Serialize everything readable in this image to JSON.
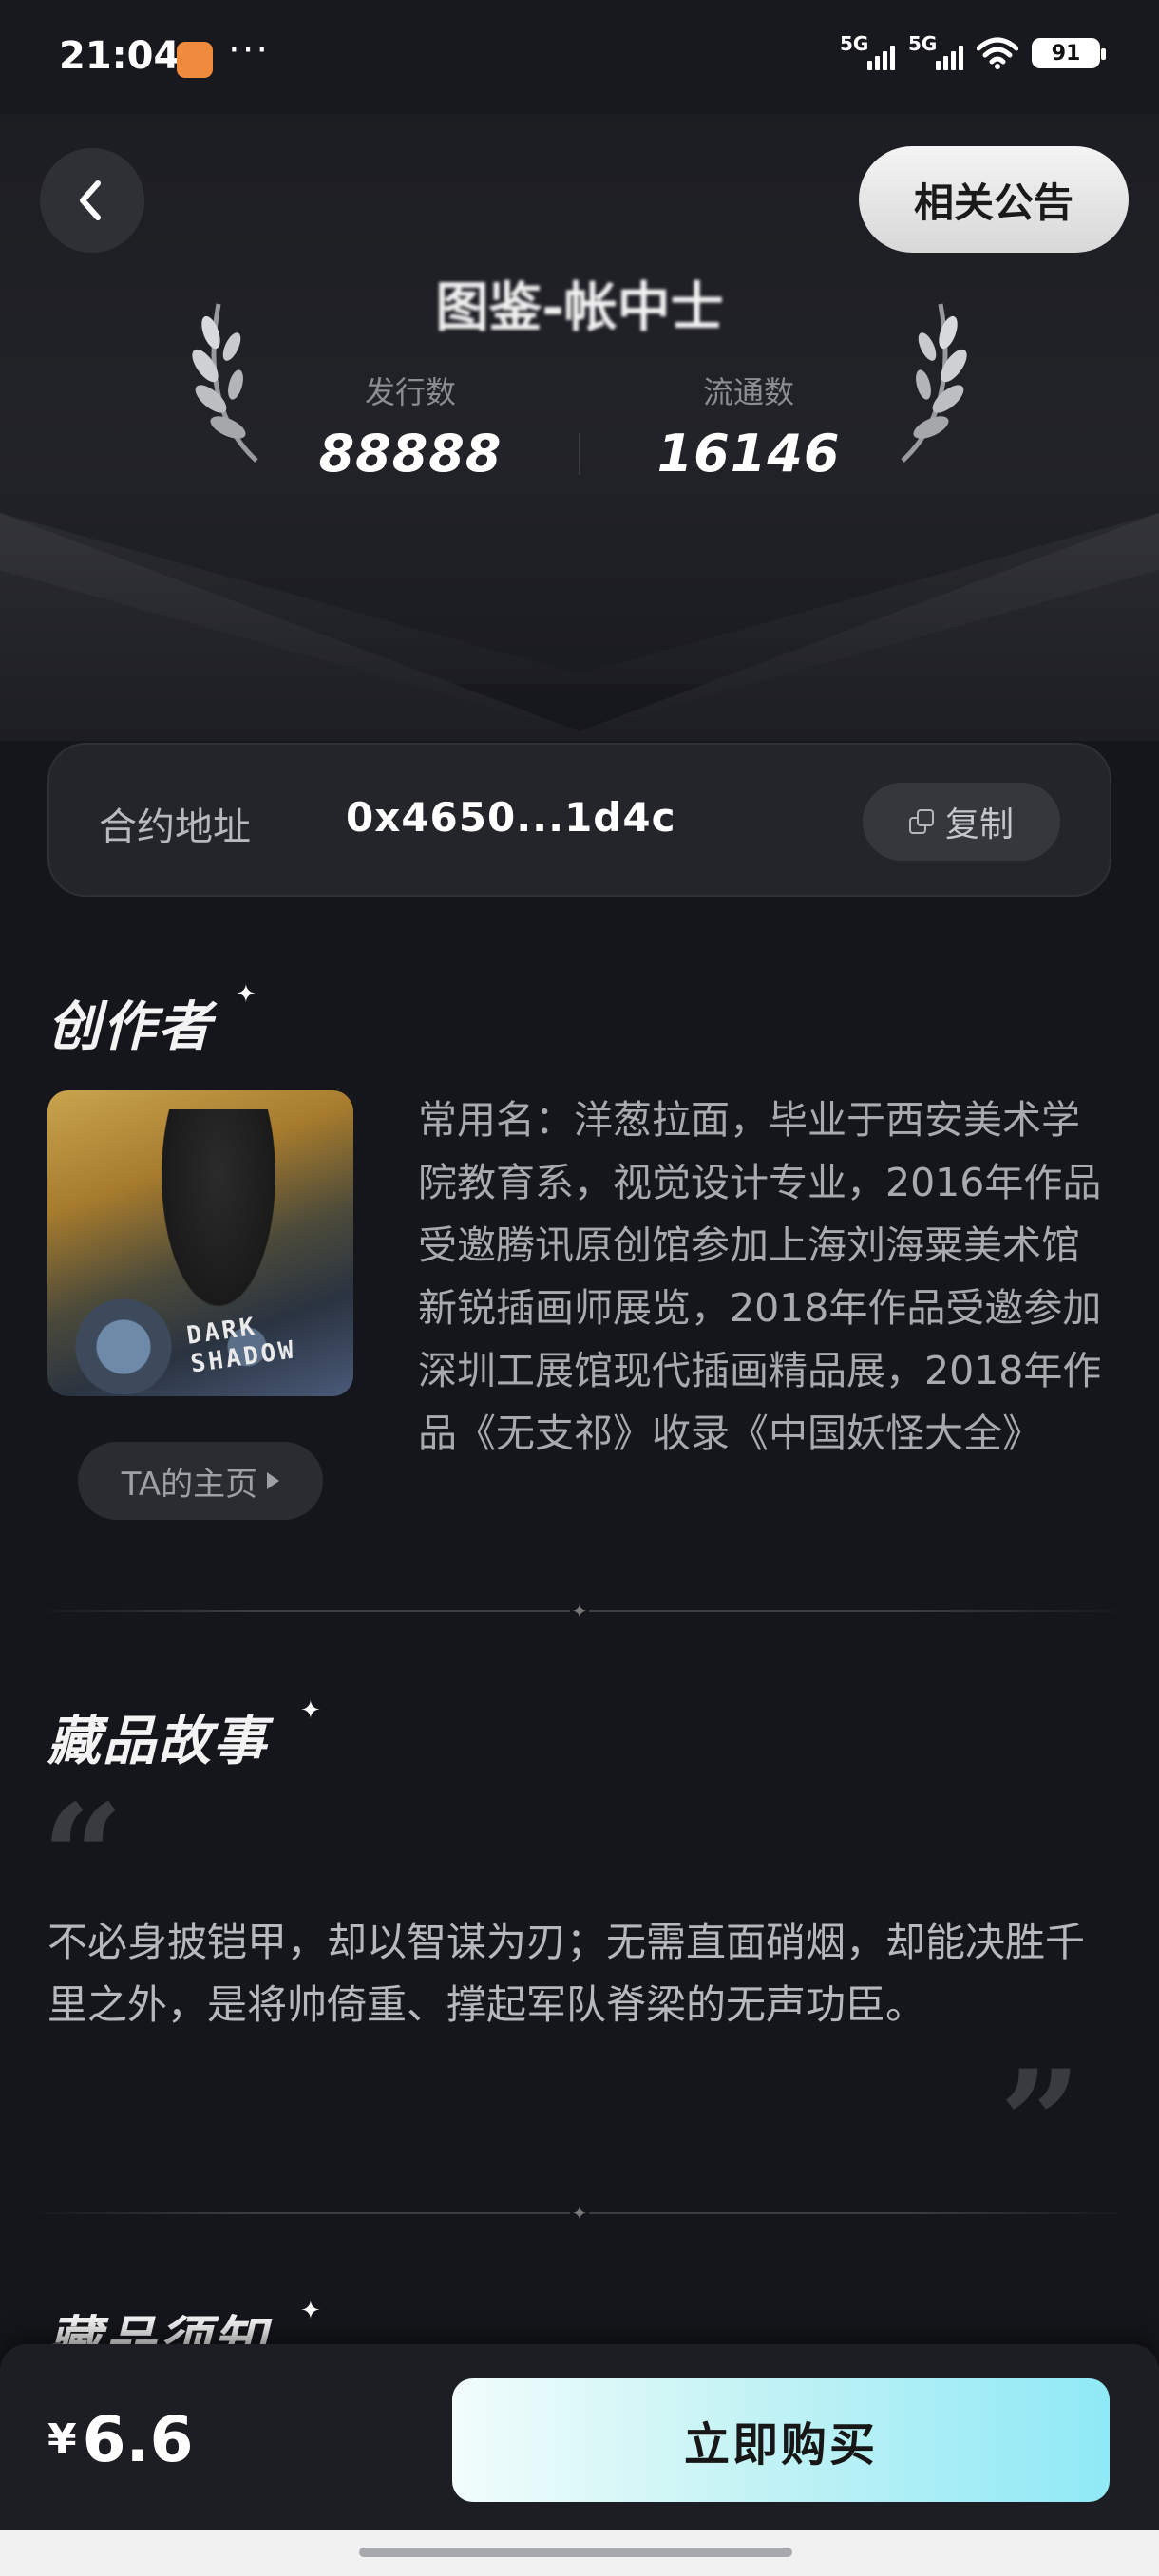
{
  "status_bar": {
    "time": "21:04",
    "more": "···",
    "net1": "5G",
    "net2": "5G",
    "battery": "91"
  },
  "header": {
    "back_icon": "chevron-left-icon",
    "notice_label": "相关公告"
  },
  "hero": {
    "title_partial": "图鉴-帐中士",
    "issue_label": "发行数",
    "issue_value": "88888",
    "circulation_label": "流通数",
    "circulation_value": "16146"
  },
  "contract": {
    "label": "合约地址",
    "address": "0x4650...1d4c",
    "copy_label": "复制"
  },
  "creator": {
    "title": "创作者",
    "homepage_label": "TA的主页",
    "avatar_text": "DARK SHADOW",
    "bio": "常用名：洋葱拉面，毕业于西安美术学院教育系，视觉设计专业，2016年作品受邀腾讯原创馆参加上海刘海粟美术馆新锐插画师展览，2018年作品受邀参加深圳工展馆现代插画精品展，2018年作品《无支祁》收录《中国妖怪大全》"
  },
  "story": {
    "title": "藏品故事",
    "text": "不必身披铠甲，却以智谋为刃；无需直面硝烟，却能决胜千里之外，是将帅倚重、撑起军队脊梁的无声功臣。"
  },
  "notice_section": {
    "title": "藏品须知"
  },
  "purchase": {
    "currency": "¥",
    "price": "6.6",
    "buy_label": "立即购买"
  },
  "colors": {
    "background": "#15161b",
    "buy_gradient_start": "#f2fdfc",
    "buy_gradient_end": "#8fe9f6"
  }
}
